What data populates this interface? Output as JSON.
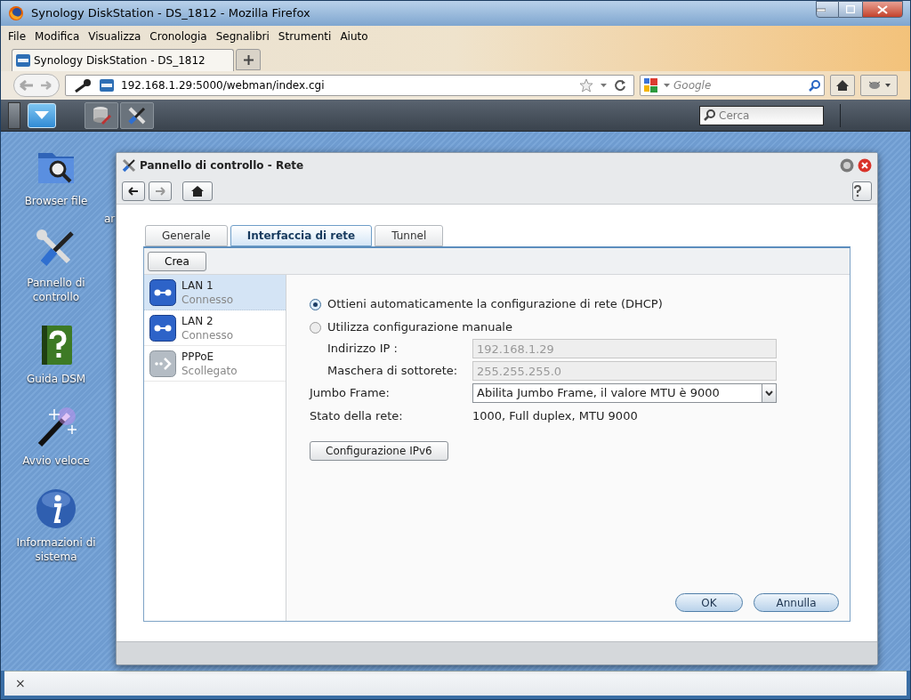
{
  "browser": {
    "title": "Synology DiskStation - DS_1812 - Mozilla Firefox",
    "menu": [
      "File",
      "Modifica",
      "Visualizza",
      "Cronologia",
      "Segnalibri",
      "Strumenti",
      "Aiuto"
    ],
    "tabs": [
      {
        "label": "Synology DiskStation - DS_1812",
        "selected": true
      }
    ],
    "address": "192.168.1.29:5000/webman/index.cgi",
    "search_placeholder": "Google"
  },
  "dsm_taskbar": {
    "search_placeholder": "Cerca"
  },
  "desktop": {
    "icons": [
      {
        "kind": "folder",
        "label": "Browser file"
      },
      {
        "kind": "tools",
        "label": "Pannello di controllo"
      },
      {
        "kind": "help",
        "label": "Guida DSM"
      },
      {
        "kind": "wand",
        "label": "Avvio veloce"
      },
      {
        "kind": "info",
        "label": "Informazioni di sistema"
      }
    ],
    "partial_label": "ar"
  },
  "dialog": {
    "title": "Pannello di controllo - Rete",
    "tabs": [
      {
        "label": "Generale",
        "selected": false
      },
      {
        "label": "Interfaccia di rete",
        "selected": true
      },
      {
        "label": "Tunnel",
        "selected": false
      }
    ],
    "create_button": "Crea",
    "interfaces": [
      {
        "kind": "lan",
        "name": "LAN 1",
        "status": "Connesso",
        "selected": true
      },
      {
        "kind": "lan",
        "name": "LAN 2",
        "status": "Connesso",
        "selected": false
      },
      {
        "kind": "pppoe",
        "name": "PPPoE",
        "status": "Scollegato",
        "selected": false
      }
    ],
    "network_mode": [
      {
        "label": "Ottieni automaticamente la configurazione di rete (DHCP)",
        "selected": true
      },
      {
        "label": "Utilizza configurazione manuale",
        "selected": false
      }
    ],
    "fields": [
      {
        "label": "Indirizzo IP :",
        "value": "192.168.1.29",
        "disabled": true
      },
      {
        "label": "Maschera di sottorete:",
        "value": "255.255.255.0",
        "disabled": true
      }
    ],
    "jumbo_frame": {
      "label": "Jumbo Frame:",
      "value": "Abilita Jumbo Frame, il valore MTU è 9000"
    },
    "network_status": {
      "label": "Stato della rete:",
      "value": "1000, Full duplex, MTU 9000"
    },
    "ipv6_button": "Configurazione IPv6",
    "buttons": [
      "OK",
      "Annulla"
    ]
  },
  "status_bar": {
    "close_glyph": "×"
  }
}
